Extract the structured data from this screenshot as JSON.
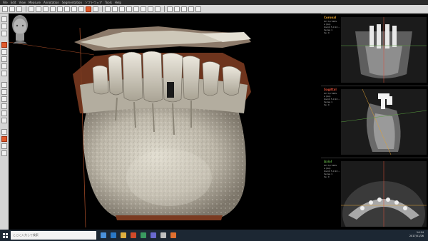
{
  "menu": [
    "File",
    "Edit",
    "View",
    "Measure",
    "Annotation",
    "Segmentation",
    "ソフトウェア",
    "Tools",
    "Help"
  ],
  "panels": [
    {
      "label": "Coronal",
      "color": "#e0a030",
      "info": [
        "HIT 5/7 MPS",
        "A (SA)",
        "OsiriX 5.0 10 ...",
        "Series 1",
        "Se: 0"
      ]
    },
    {
      "label": "Sagittal",
      "color": "#e0503a",
      "info": [
        "HIT 5/7 MPS",
        "A (SA)",
        "OsiriX 5.0 10 ...",
        "Series 1",
        "Se: 0"
      ]
    },
    {
      "label": "Axial",
      "color": "#5aa040",
      "info": [
        "HIT 5/7 MPS",
        "A (SA)",
        "OsiriX 5.0 10 ...",
        "Series 1",
        "Se: 0"
      ]
    }
  ],
  "taskbar": {
    "search_placeholder": "ここに入力して検索",
    "time": "14:14",
    "date": "2017/01/26"
  },
  "colors": {
    "bone": "#c8c3b6",
    "bone_shadow": "#7d766a",
    "tissue": "#7a3a20",
    "accent": "#e05a2b"
  }
}
